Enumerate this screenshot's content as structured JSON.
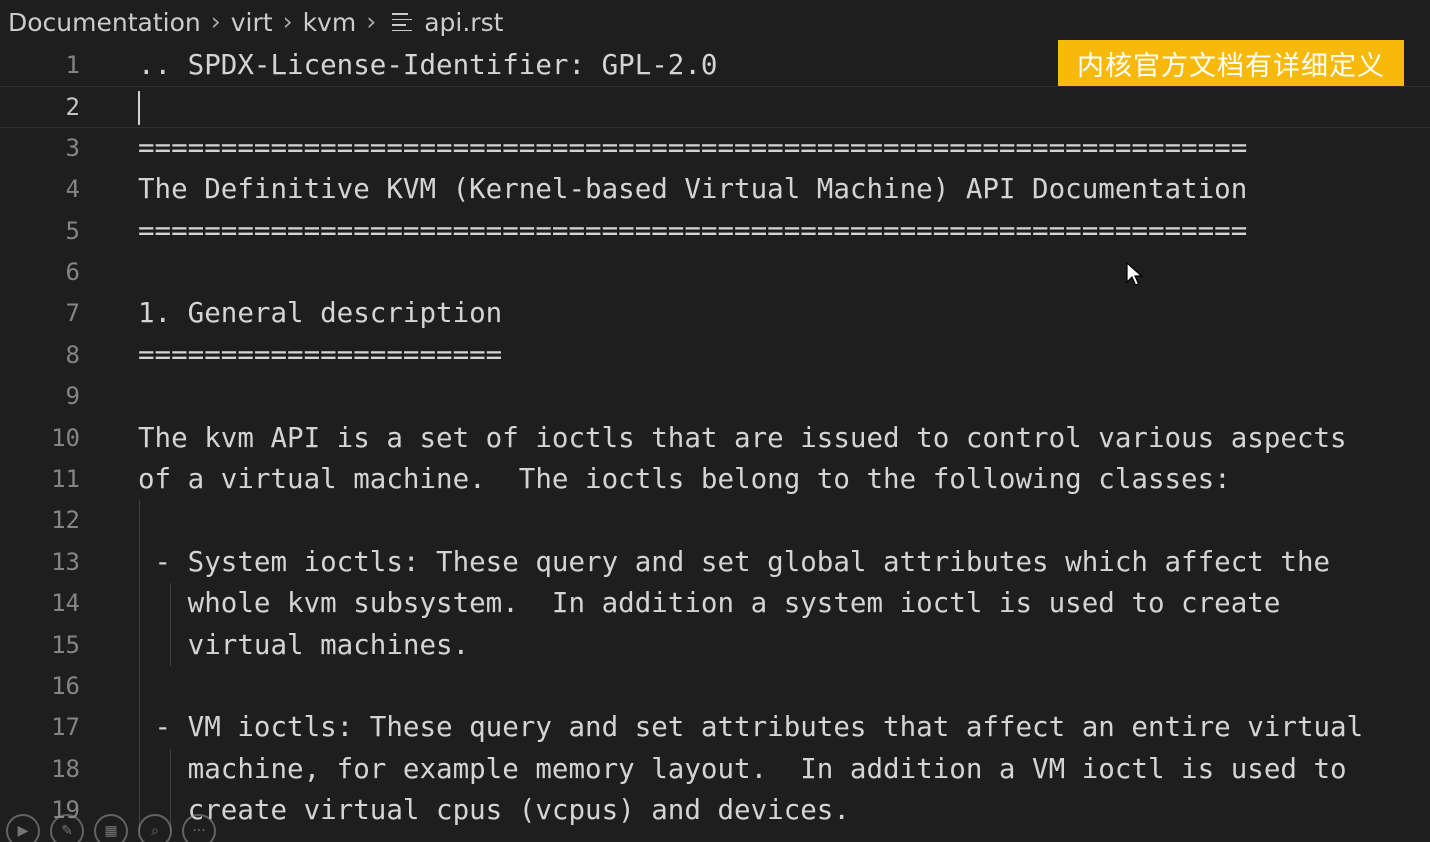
{
  "breadcrumb": {
    "items": [
      "Documentation",
      "virt",
      "kvm"
    ],
    "file_name": "api.rst",
    "file_icon": "text-lines-icon"
  },
  "banner": {
    "text": "内核官方文档有详细定义",
    "color": "#f6b90c"
  },
  "editor": {
    "current_line": 2,
    "lines": [
      {
        "number": "1",
        "text": ".. SPDX-License-Identifier: GPL-2.0"
      },
      {
        "number": "2",
        "text": ""
      },
      {
        "number": "3",
        "text": "==================================================================="
      },
      {
        "number": "4",
        "text": "The Definitive KVM (Kernel-based Virtual Machine) API Documentation"
      },
      {
        "number": "5",
        "text": "==================================================================="
      },
      {
        "number": "6",
        "text": ""
      },
      {
        "number": "7",
        "text": "1. General description"
      },
      {
        "number": "8",
        "text": "======================"
      },
      {
        "number": "9",
        "text": ""
      },
      {
        "number": "10",
        "text": "The kvm API is a set of ioctls that are issued to control various aspects"
      },
      {
        "number": "11",
        "text": "of a virtual machine.  The ioctls belong to the following classes:"
      },
      {
        "number": "12",
        "text": ""
      },
      {
        "number": "13",
        "text": " - System ioctls: These query and set global attributes which affect the"
      },
      {
        "number": "14",
        "text": "   whole kvm subsystem.  In addition a system ioctl is used to create"
      },
      {
        "number": "15",
        "text": "   virtual machines."
      },
      {
        "number": "16",
        "text": ""
      },
      {
        "number": "17",
        "text": " - VM ioctls: These query and set attributes that affect an entire virtual"
      },
      {
        "number": "18",
        "text": "   machine, for example memory layout.  In addition a VM ioctl is used to"
      },
      {
        "number": "19",
        "text": "   create virtual cpus (vcpus) and devices."
      }
    ]
  },
  "toolbar": {
    "buttons": [
      {
        "name": "play-icon",
        "glyph": "▶"
      },
      {
        "name": "pen-icon",
        "glyph": "✎"
      },
      {
        "name": "layout-icon",
        "glyph": "▦"
      },
      {
        "name": "zoom-icon",
        "glyph": "⌕"
      },
      {
        "name": "more-icon",
        "glyph": "···"
      }
    ]
  }
}
